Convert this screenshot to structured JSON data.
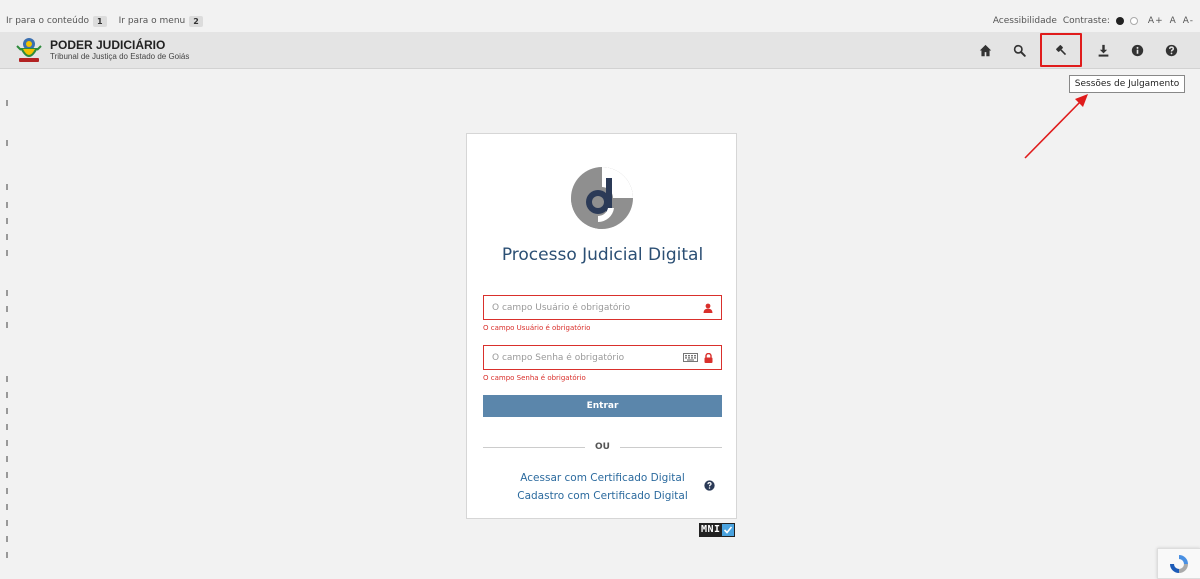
{
  "accessibility_bar": {
    "skip_content_label": "Ir para o conteúdo",
    "skip_content_key": "1",
    "skip_menu_label": "Ir para o menu",
    "skip_menu_key": "2",
    "accessibility_label": "Acessibilidade",
    "contrast_label": "Contraste:",
    "font_increase": "A+",
    "font_normal": "A",
    "font_decrease": "A-"
  },
  "header": {
    "title": "PODER JUDICIÁRIO",
    "subtitle": "Tribunal de Justiça do Estado de Goiás",
    "tools": [
      {
        "name": "home-icon"
      },
      {
        "name": "search-icon"
      },
      {
        "name": "gavel-icon"
      },
      {
        "name": "download-icon"
      },
      {
        "name": "info-icon"
      },
      {
        "name": "help-icon"
      }
    ],
    "tooltip": "Sessões de Julgamento"
  },
  "login": {
    "title": "Processo Judicial Digital",
    "user_placeholder": "O campo Usuário é obrigatório",
    "user_error": "O campo Usuário é obrigatório",
    "password_placeholder": "O campo Senha é obrigatório",
    "password_error": "O campo Senha é obrigatório",
    "submit_label": "Entrar",
    "divider_label": "OU",
    "cert_login_label": "Acessar com Certificado Digital",
    "cert_register_label": "Cadastro com Certificado Digital"
  },
  "badge": {
    "text": "MNI"
  },
  "colors": {
    "accent": "#5b86ab",
    "error": "#d9302c",
    "link": "#2b6a9e",
    "title": "#2b4f74",
    "highlight": "#e01c1c"
  }
}
